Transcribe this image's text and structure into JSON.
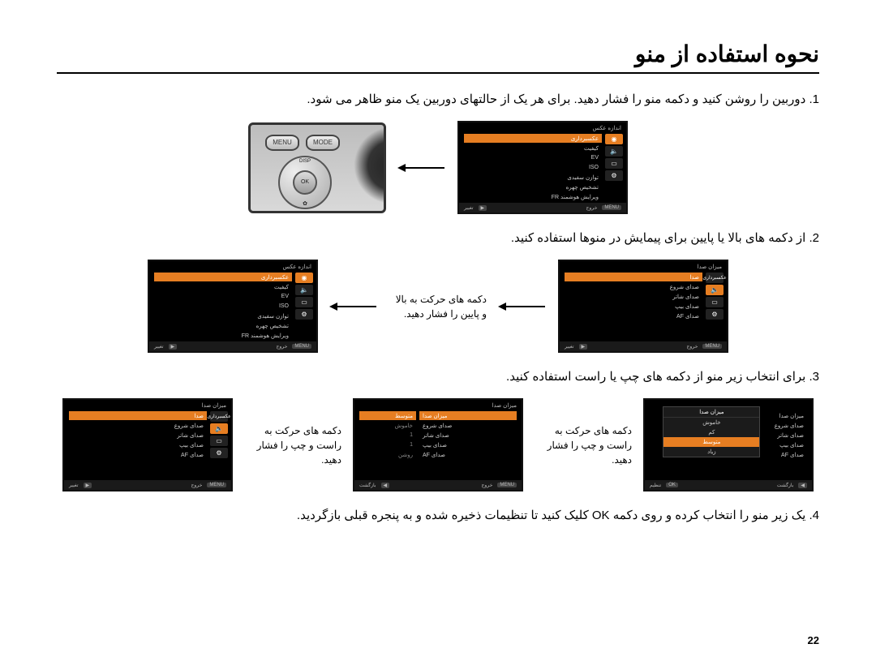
{
  "title": "نحوه استفاده از منو",
  "steps": {
    "s1": "1. دوربین را روشن کنید و دکمه منو را فشار دهید. برای هر یک از حالتهای دوربین یک منو ظاهر می شود.",
    "s2": "2. از دکمه های بالا یا پایین برای پیمایش در منوها استفاده کنید.",
    "s3": "3. برای انتخاب زیر منو از دکمه های چپ یا راست استفاده کنید.",
    "s4": "4. یک زیر منو را انتخاب کرده و روی دکمه OK کلیک کنید تا تنظیمات ذخیره شده و به پنجره قبلی بازگردید."
  },
  "instructions": {
    "i2": "دکمه های حرکت به بالا و پایین را فشار دهید.",
    "i3a": "دکمه های حرکت به راست و چپ را فشار دهید.",
    "i3b": "دکمه های حرکت به راست و چپ را فشار دهید."
  },
  "camera": {
    "menu": "MENU",
    "mode": "MODE",
    "disp": "DISP",
    "ok": "OK"
  },
  "menuCommon": {
    "header": "اندازه عکس",
    "tab_shoot": "عکسبرداری",
    "tab_sound": "صدا",
    "tab_disp": "نمایشگر",
    "tab_setup": "تنظیمات",
    "exit": "خروج",
    "change": "تغییر",
    "back": "بازگشت",
    "set": "تنظیم",
    "menu_chip": "MENU",
    "play_chip": "▶",
    "ok_chip": "OK"
  },
  "shootMenu": {
    "items": [
      "اندازه عکس",
      "کیفیت",
      "EV",
      "ISO",
      "توازن سفیدی",
      "تشخیص چهره",
      "ویرایش هوشمند FR"
    ]
  },
  "soundMenu": {
    "header": "میزان صدا",
    "items": [
      "میزان صدا",
      "صدای شروع",
      "صدای شاتر",
      "صدای بیپ",
      "صدای AF"
    ]
  },
  "soundValues": {
    "vol": "متوسط",
    "start": "خاموش",
    "shutter": "1",
    "beep": "1",
    "af": "روشن"
  },
  "volumePopup": {
    "title": "میزان صدا",
    "opts": [
      "خاموش",
      "کم",
      "متوسط",
      "زیاد"
    ]
  },
  "pagenum": "22"
}
